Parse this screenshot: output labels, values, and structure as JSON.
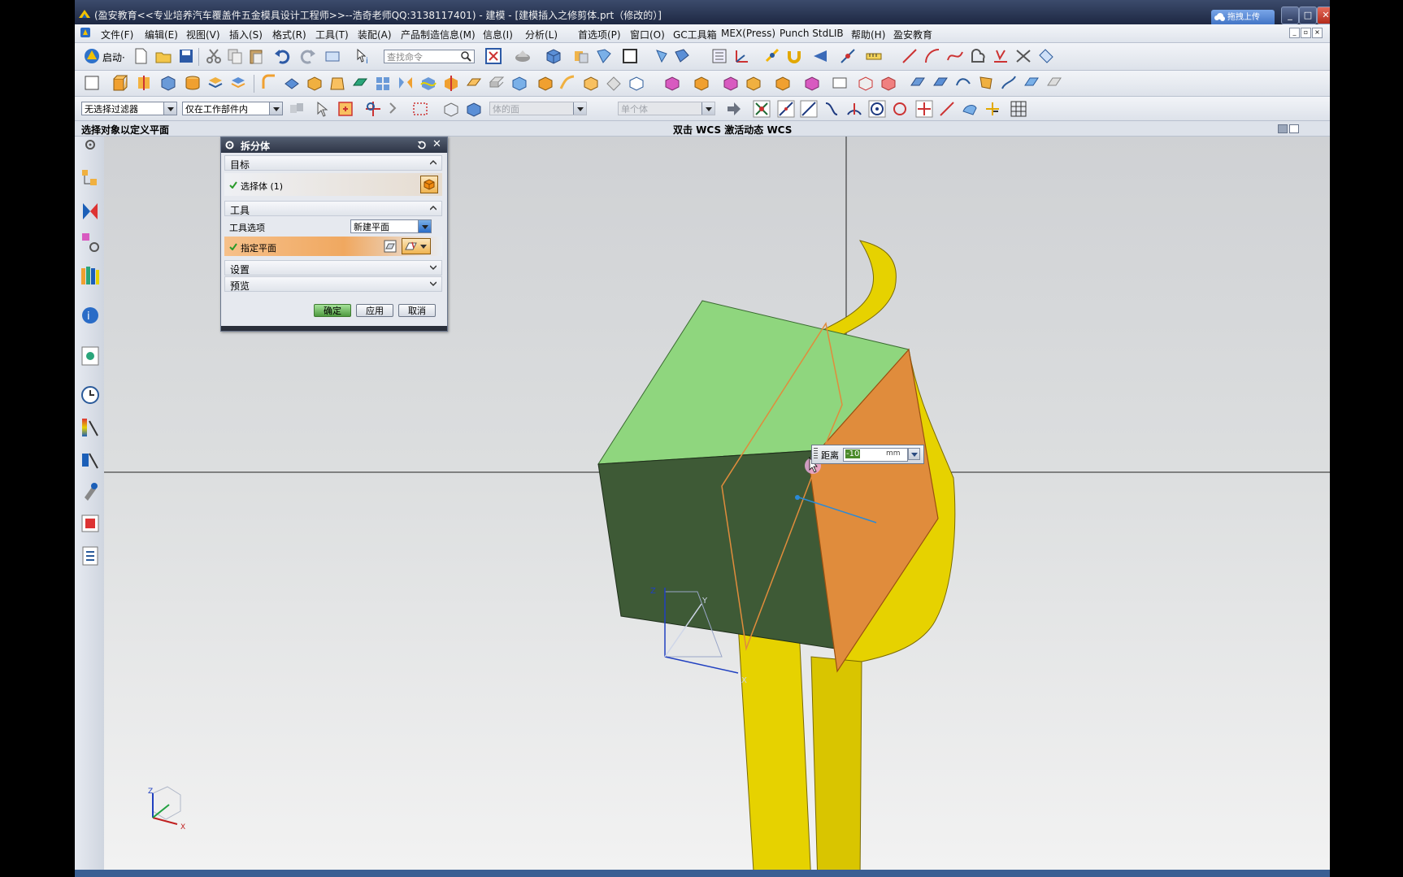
{
  "window": {
    "title": "(盈安教育<<专业培养汽车覆盖件五金模具设计工程师>>--浩奇老师QQ:3138117401) - 建模 - [建模插入之修剪体.prt（修改的）]",
    "upload_label": "拖拽上传",
    "controls": [
      "_",
      "□",
      "✕"
    ]
  },
  "menu": {
    "items": [
      "文件(F)",
      "编辑(E)",
      "视图(V)",
      "插入(S)",
      "格式(R)",
      "工具(T)",
      "装配(A)",
      "产品制造信息(M)",
      "信息(I)",
      "分析(L)",
      "首选项(P)",
      "窗口(O)",
      "GC工具箱",
      "MEX(Press)",
      "Punch StdLIB",
      "帮助(H)",
      "盈安教育"
    ]
  },
  "toolbar": {
    "start_label": "启动·",
    "search_placeholder": "查找命令"
  },
  "selection_bar": {
    "filter": "无选择过滤器",
    "scope": "仅在工作部件内",
    "face_rule": "体的面",
    "body_rule": "单个体"
  },
  "status": {
    "prompt": "选择对象以定义平面",
    "hint": "双击 WCS 激活动态 WCS"
  },
  "dialog": {
    "title": "拆分体",
    "target_section": "目标",
    "select_body": "选择体 (1)",
    "tool_section": "工具",
    "tool_option_label": "工具选项",
    "tool_option_value": "新建平面",
    "specify_plane": "指定平面",
    "settings_section": "设置",
    "preview_section": "预览",
    "ok": "确定",
    "apply": "应用",
    "cancel": "取消"
  },
  "distance_input": {
    "label": "距离",
    "value": "-10",
    "unit": "mm"
  },
  "axes": {
    "x": "X",
    "y": "Y",
    "z": "Z"
  },
  "colors": {
    "cube_top": "#8fd67e",
    "cube_front": "#3e5a36",
    "sheet": "#e6d200",
    "plane": "#e08c3c"
  }
}
